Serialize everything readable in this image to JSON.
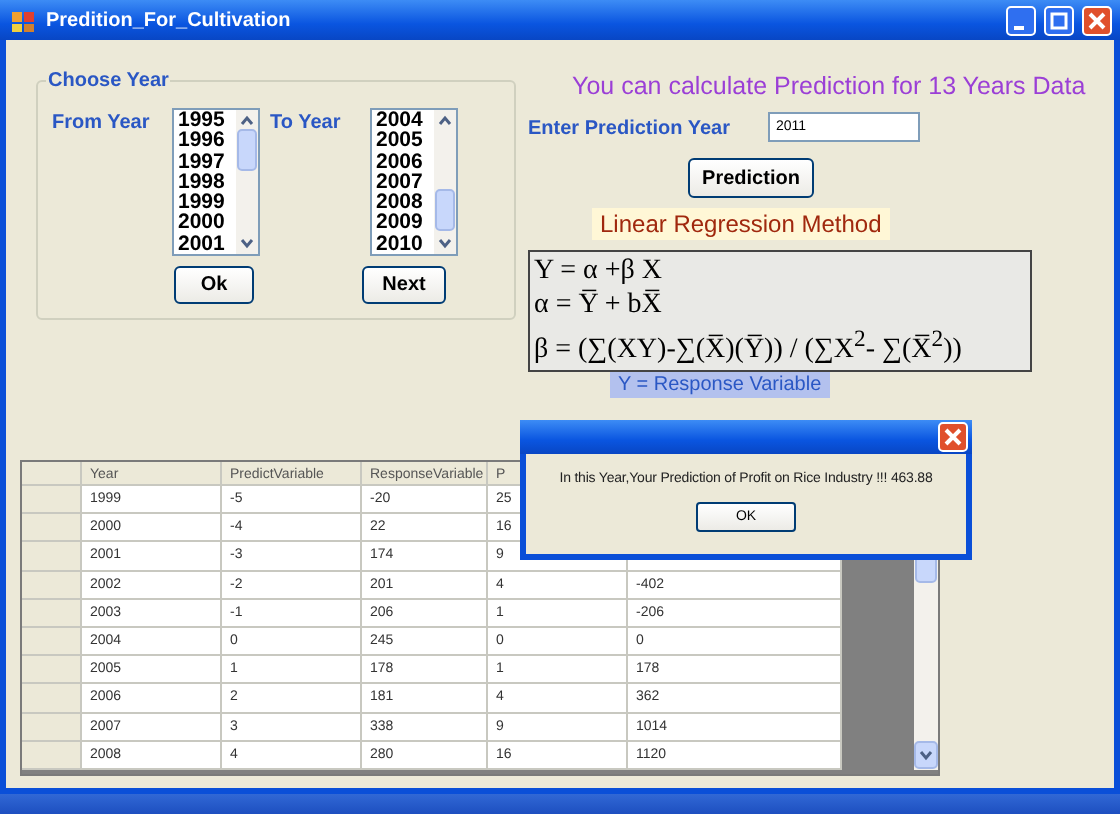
{
  "window": {
    "title": "Predition_For_Cultivation"
  },
  "choose_year": {
    "title": "Choose Year",
    "from_label": "From Year",
    "to_label": "To Year",
    "from_list": [
      {
        "label": "1995",
        "selected": false
      },
      {
        "label": "1996",
        "selected": false
      },
      {
        "label": "1997",
        "selected": false
      },
      {
        "label": "1998",
        "selected": false
      },
      {
        "label": "1999",
        "selected": false
      },
      {
        "label": "2000",
        "selected": false
      },
      {
        "label": "2001",
        "selected": false
      }
    ],
    "to_list": [
      {
        "label": "2004",
        "selected": false
      },
      {
        "label": "2005",
        "selected": false
      },
      {
        "label": "2006",
        "selected": false
      },
      {
        "label": "2007",
        "selected": false
      },
      {
        "label": "2008",
        "selected": false
      },
      {
        "label": "2009",
        "selected": false
      },
      {
        "label": "2010",
        "selected": false
      }
    ],
    "buttons": [
      "Ok",
      "Next"
    ]
  },
  "prediction": {
    "heading": "You can calculate Prediction for  13 Years Data",
    "year_label": "Enter Prediction Year",
    "year_value": "2011",
    "button": "Prediction",
    "method": "Linear Regression Method",
    "formula": [
      "Y = α +β X",
      "α  =  Y̅  +  bX̅",
      "β = (∑(XY)-∑(X̅)(Y̅)) / (∑X$^{2}$- ∑(X̅$^{2}$))"
    ],
    "legend": "Y = Response Variable"
  },
  "table": {
    "columns": [
      "Year",
      "PredictVariable",
      "ResponseVariable",
      "P"
    ],
    "rows": [
      {
        "selected": false,
        "cells": [
          "1999",
          "-5",
          "-20",
          "25",
          null
        ]
      },
      {
        "selected": false,
        "cells": [
          "2000",
          "-4",
          "22",
          "16",
          null
        ]
      },
      {
        "selected": false,
        "cells": [
          "2001",
          "-3",
          "174",
          "9",
          null
        ]
      },
      {
        "selected": false,
        "cells": [
          "2002",
          "-2",
          "201",
          "4",
          "-402"
        ]
      },
      {
        "selected": false,
        "cells": [
          "2003",
          "-1",
          "206",
          "1",
          "-206"
        ]
      },
      {
        "selected": false,
        "cells": [
          "2004",
          "0",
          "245",
          "0",
          "0"
        ]
      },
      {
        "selected": false,
        "cells": [
          "2005",
          "1",
          "178",
          "1",
          "178"
        ]
      },
      {
        "selected": false,
        "cells": [
          "2006",
          "2",
          "181",
          "4",
          "362"
        ]
      },
      {
        "selected": false,
        "cells": [
          "2007",
          "3",
          "338",
          "9",
          "1014"
        ]
      },
      {
        "selected": false,
        "cells": [
          "2008",
          "4",
          "280",
          "16",
          "1120"
        ]
      }
    ]
  },
  "dialog": {
    "message": "In this Year,Your Prediction of Profit on Rice Industry !!! 463.88",
    "button": "OK"
  }
}
